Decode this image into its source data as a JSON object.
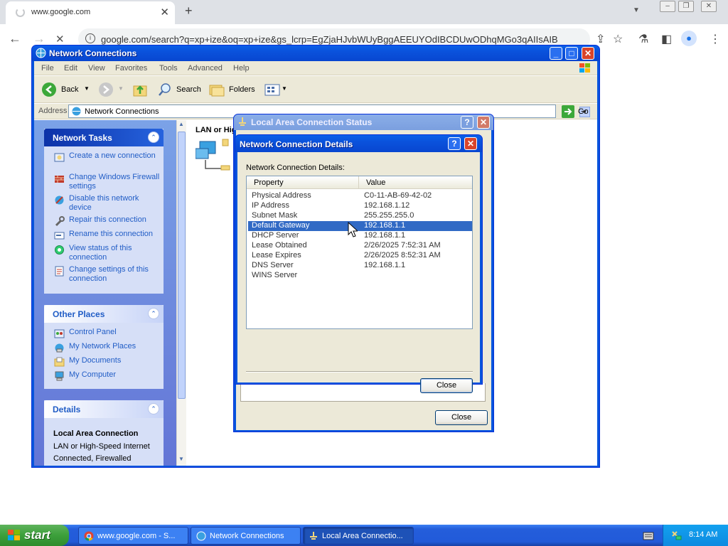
{
  "browser": {
    "tab_title": "www.google.com",
    "url": "google.com/search?q=xp+ize&oq=xp+ize&gs_lcrp=EgZjaHJvbWUyBggAEEUYOdIBCDUwODhqMGo3qAIIsAIB"
  },
  "nc_window": {
    "title": "Network Connections",
    "menu": [
      "File",
      "Edit",
      "View",
      "Favorites",
      "Tools",
      "Advanced",
      "Help"
    ],
    "toolbar": {
      "back": "Back",
      "search": "Search",
      "folders": "Folders"
    },
    "address_label": "Address",
    "address_value": "Network Connections",
    "go_label": "Go",
    "content_header": "LAN or Hig"
  },
  "task_pane": {
    "network_tasks": {
      "title": "Network Tasks",
      "items": [
        "Create a new connection",
        "Change Windows Firewall settings",
        "Disable this network device",
        "Repair this connection",
        "Rename this connection",
        "View status of this connection",
        "Change settings of this connection"
      ]
    },
    "other_places": {
      "title": "Other Places",
      "items": [
        "Control Panel",
        "My Network Places",
        "My Documents",
        "My Computer"
      ]
    },
    "details": {
      "title": "Details",
      "name": "Local Area Connection",
      "line1": "LAN or High-Speed Internet",
      "line2": "Connected, Firewalled"
    }
  },
  "status_dialog": {
    "title": "Local Area Connection Status",
    "close_label": "Close"
  },
  "details_dialog": {
    "title": "Network Connection Details",
    "section_label": "Network Connection Details:",
    "col_property": "Property",
    "col_value": "Value",
    "rows": [
      {
        "property": "Physical Address",
        "value": "C0-11-AB-69-42-02"
      },
      {
        "property": "IP Address",
        "value": "192.168.1.12"
      },
      {
        "property": "Subnet Mask",
        "value": "255.255.255.0"
      },
      {
        "property": "Default Gateway",
        "value": "192.168.1.1"
      },
      {
        "property": "DHCP Server",
        "value": "192.168.1.1"
      },
      {
        "property": "Lease Obtained",
        "value": "2/26/2025 7:52:31 AM"
      },
      {
        "property": "Lease Expires",
        "value": "2/26/2025 8:52:31 AM"
      },
      {
        "property": "DNS Server",
        "value": "192.168.1.1"
      },
      {
        "property": "WINS Server",
        "value": ""
      }
    ],
    "selected_row": 3,
    "close_label": "Close"
  },
  "taskbar": {
    "start_label": "start",
    "buttons": [
      "www.google.com - S...",
      "Network Connections",
      "Local Area Connectio..."
    ],
    "active_button": 2,
    "clock": "8:14 AM"
  },
  "colors": {
    "xp_title": "#0a52dc",
    "selection": "#316ac5",
    "task_link": "#215dc6",
    "start_green": "#3c9f3b"
  }
}
